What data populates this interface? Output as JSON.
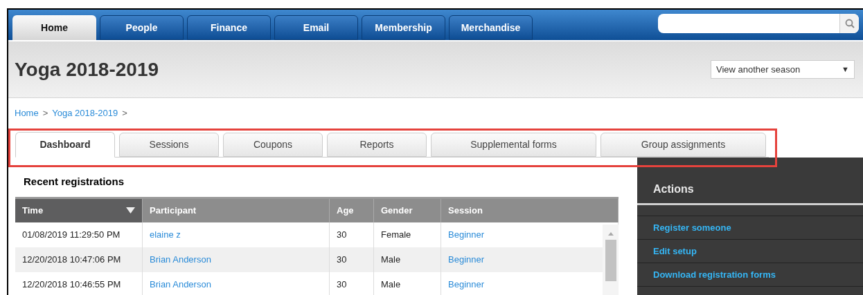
{
  "nav_tabs": [
    {
      "label": "Home",
      "selected": true
    },
    {
      "label": "People",
      "selected": false
    },
    {
      "label": "Finance",
      "selected": false
    },
    {
      "label": "Email",
      "selected": false
    },
    {
      "label": "Membership",
      "selected": false
    },
    {
      "label": "Merchandise",
      "selected": false
    }
  ],
  "page_title": "Yoga 2018-2019",
  "season_select": {
    "value": "View another season",
    "arrow": "▼"
  },
  "breadcrumb": [
    {
      "label": "Home",
      "sep": ">"
    },
    {
      "label": "Yoga 2018-2019",
      "sep": ">"
    }
  ],
  "section_tabs": [
    {
      "label": "Dashboard",
      "selected": true
    },
    {
      "label": "Sessions",
      "selected": false
    },
    {
      "label": "Coupons",
      "selected": false
    },
    {
      "label": "Reports",
      "selected": false
    },
    {
      "label": "Supplemental forms",
      "selected": false
    },
    {
      "label": "Group assignments",
      "selected": false
    }
  ],
  "recent_registrations": {
    "title": "Recent registrations",
    "columns": [
      {
        "label": "Time",
        "sorted": true
      },
      {
        "label": "Participant",
        "sorted": false
      },
      {
        "label": "Age",
        "sorted": false
      },
      {
        "label": "Gender",
        "sorted": false
      },
      {
        "label": "Session",
        "sorted": false
      }
    ],
    "rows": [
      [
        "01/08/2019 11:29:50 PM",
        "elaine z",
        "30",
        "Female",
        "Beginner"
      ],
      [
        "12/20/2018 10:47:06 PM",
        "Brian Anderson",
        "30",
        "Male",
        "Beginner"
      ],
      [
        "12/20/2018 10:46:55 PM",
        "Brian Anderson",
        "30",
        "Male",
        "Beginner"
      ]
    ]
  },
  "actions": {
    "title": "Actions",
    "items": [
      "Register someone",
      "Edit setup",
      "Download registration forms"
    ]
  }
}
